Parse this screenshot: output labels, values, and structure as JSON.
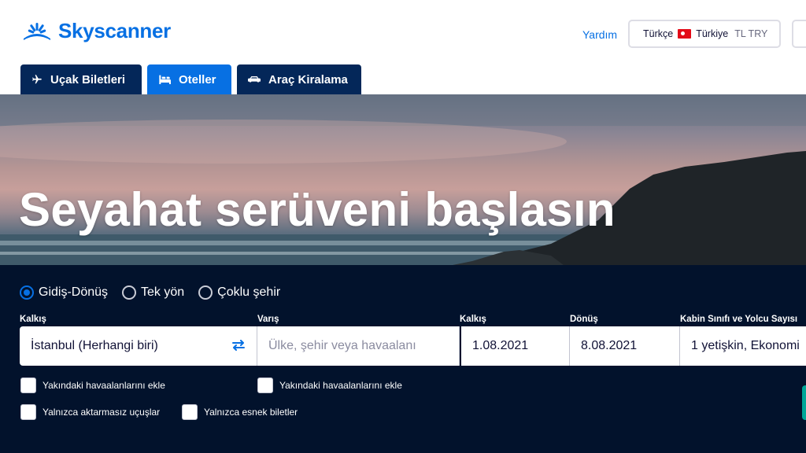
{
  "header": {
    "brand": "Skyscanner",
    "help": "Yardım",
    "locale": {
      "language": "Türkçe",
      "country": "Türkiye",
      "currency": "TL TRY"
    }
  },
  "tabs": [
    {
      "label": "Uçak Biletleri",
      "icon": "airplane-icon",
      "active": false
    },
    {
      "label": "Oteller",
      "icon": "bed-icon",
      "active": true
    },
    {
      "label": "Araç Kiralama",
      "icon": "car-icon",
      "active": false
    }
  ],
  "hero": {
    "title": "Seyahat serüveni başlasın"
  },
  "search": {
    "trip_types": [
      {
        "label": "Gidiş-Dönüş",
        "checked": true
      },
      {
        "label": "Tek yön",
        "checked": false
      },
      {
        "label": "Çoklu şehir",
        "checked": false
      }
    ],
    "origin": {
      "label": "Kalkış",
      "value": "İstanbul (Herhangi biri)"
    },
    "destination": {
      "label": "Varış",
      "placeholder": "Ülke, şehir veya havaalanı"
    },
    "depart": {
      "label": "Kalkış",
      "value": "1.08.2021"
    },
    "return": {
      "label": "Dönüş",
      "value": "8.08.2021"
    },
    "cabin": {
      "label": "Kabin Sınıfı ve Yolcu Sayısı",
      "value": "1 yetişkin, Ekonomi"
    },
    "options": {
      "nearby_origin": "Yakındaki havaalanlarını ekle",
      "nearby_destination": "Yakındaki havaalanlarını ekle",
      "direct_only": "Yalnızca aktarmasız uçuşlar",
      "flexible_only": "Yalnızca esnek biletler"
    }
  },
  "colors": {
    "brand": "#0770e3",
    "tab_dark": "#042759",
    "panel": "#02122c",
    "search_button": "#00a698"
  }
}
